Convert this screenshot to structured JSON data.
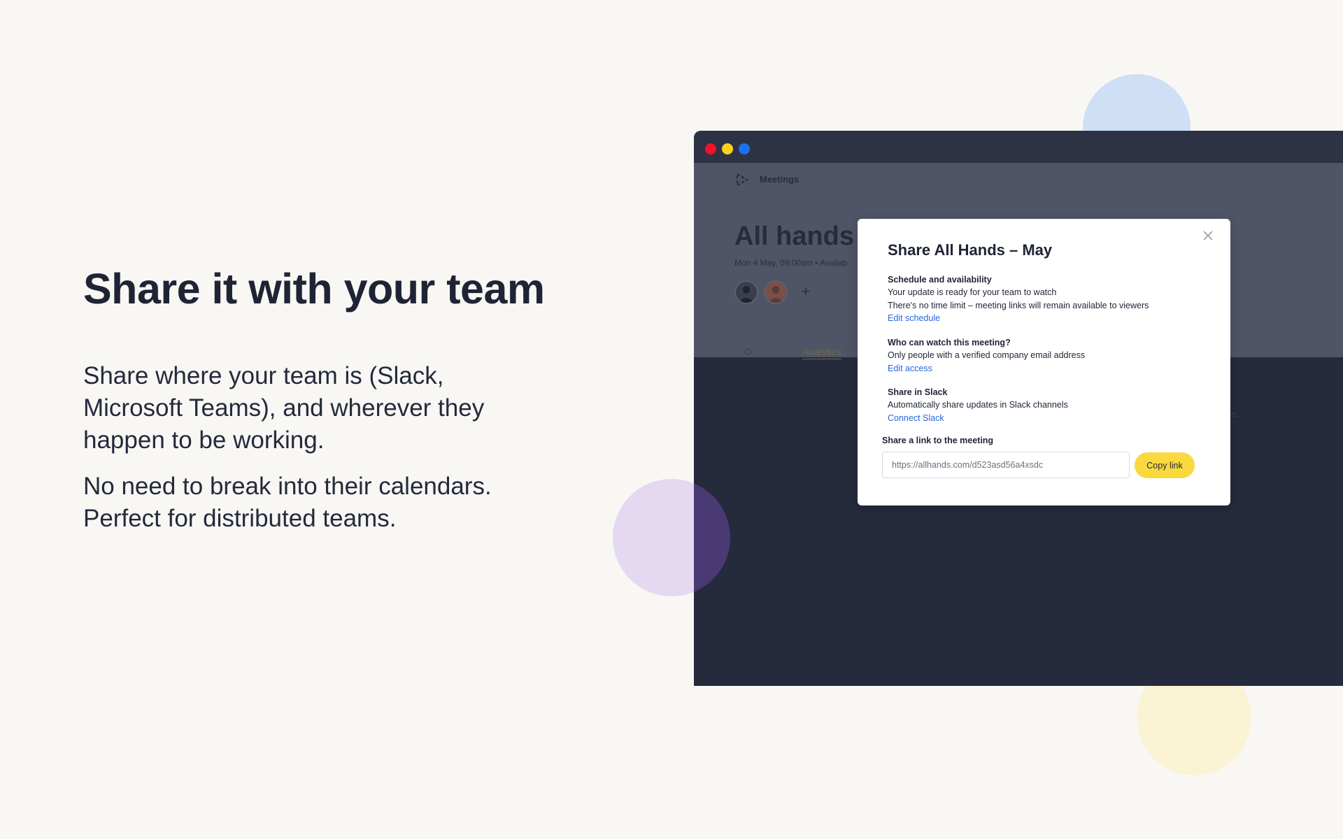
{
  "hero": {
    "headline": "Share it with your team",
    "paragraph_1": "Share where your team is (Slack, Microsoft Teams), and wherever they happen to be working.",
    "paragraph_2": "No need to break into their calendars. Perfect for distributed teams."
  },
  "window": {
    "nav_label": "Meetings",
    "meeting_title": "All hands r",
    "meeting_meta": "Mon 4 May, 09:00am • Availab",
    "add_symbol": "+",
    "tab_analytics": "Analytics",
    "tab_other": "O",
    "ghost_text": "t and e."
  },
  "modal": {
    "title": "Share All Hands – May",
    "schedule": {
      "heading": "Schedule and availability",
      "line_1": "Your update is ready for your team to watch",
      "line_2": "There's no time limit – meeting links will remain available to viewers",
      "link": "Edit schedule"
    },
    "access": {
      "heading": "Who can watch this meeting?",
      "line_1": "Only people with a verified company email address",
      "link": "Edit access"
    },
    "slack": {
      "heading": "Share in Slack",
      "line_1": "Automatically share updates in Slack channels",
      "link": "Connect Slack"
    },
    "share_link": {
      "label": "Share a link to the meeting",
      "value": "https://allhands.com/d523asd56a4xsdc",
      "button": "Copy link"
    }
  },
  "colors": {
    "accent_yellow": "#fad93e",
    "link_blue": "#2368e0",
    "dark_navy": "#262b3d"
  },
  "icons": [
    "close-icon",
    "app-logo-icon",
    "plus-icon"
  ]
}
